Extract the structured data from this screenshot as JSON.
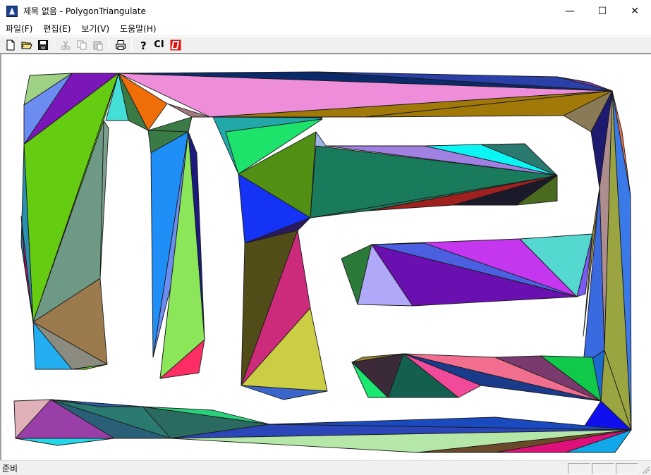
{
  "window": {
    "title": "제목 없음 - PolygonTriangulate",
    "minimize_glyph": "—",
    "maximize_glyph": "☐",
    "close_glyph": "✕"
  },
  "menu": [
    {
      "label": "파일(F)"
    },
    {
      "label": "편집(E)"
    },
    {
      "label": "보기(V)"
    },
    {
      "label": "도움말(H)"
    }
  ],
  "toolbar": {
    "buttons": [
      {
        "icon": "new-file-icon"
      },
      {
        "icon": "open-folder-icon"
      },
      {
        "icon": "save-icon"
      },
      {
        "icon": "cut-icon",
        "disabled": true
      },
      {
        "icon": "copy-icon",
        "disabled": true
      },
      {
        "icon": "paste-icon",
        "disabled": true
      },
      {
        "icon": "print-icon"
      },
      {
        "icon": "help-icon"
      }
    ],
    "clear_label": "CI"
  },
  "status": {
    "text": "준비"
  },
  "colors": {
    "accent": "#2a6fd6",
    "pink_top": "#ee8edb",
    "lime": "#66cc11",
    "teal": "#1e7a60",
    "purple": "#7b17b8",
    "olive": "#9aa441",
    "blue": "#1133ee",
    "red_icon": "#e01010"
  }
}
